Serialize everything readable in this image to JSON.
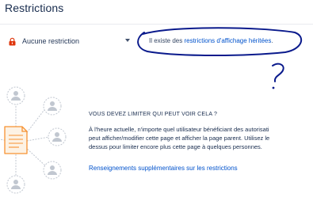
{
  "page": {
    "title": "Restrictions"
  },
  "restriction_select": {
    "selected": "Aucune restriction",
    "icon": "red-lock-icon",
    "chevron": "chevron-down-icon"
  },
  "inherited_notice": {
    "prefix": "Il existe des ",
    "link": "restrictions d'affichage héritées",
    "suffix": "."
  },
  "annotation": {
    "marks": "?",
    "color": "#0a1a8c"
  },
  "info": {
    "heading": "VOUS DEVEZ LIMITER QUI PEUT VOIR CELA ?",
    "lines": [
      "À l'heure actuelle, n'importe quel utilisateur bénéficiant des autorisati",
      "peut afficher/modifier cette page et afficher la page parent. Utilisez le",
      "dessus pour limiter encore plus cette page à quelques personnes."
    ],
    "link": "Renseignements supplémentaires sur les restrictions"
  },
  "colors": {
    "text": "#172b4d",
    "link": "#0052cc",
    "lock_red": "#de350b",
    "illustration_orange": "#f79232",
    "illustration_grey": "#c1c7d0"
  }
}
